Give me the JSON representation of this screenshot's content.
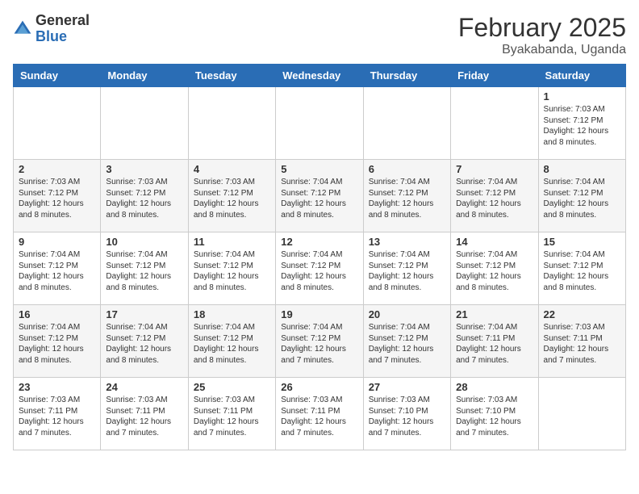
{
  "logo": {
    "general": "General",
    "blue": "Blue"
  },
  "header": {
    "month": "February 2025",
    "location": "Byakabanda, Uganda"
  },
  "weekdays": [
    "Sunday",
    "Monday",
    "Tuesday",
    "Wednesday",
    "Thursday",
    "Friday",
    "Saturday"
  ],
  "weeks": [
    [
      {
        "day": "",
        "info": ""
      },
      {
        "day": "",
        "info": ""
      },
      {
        "day": "",
        "info": ""
      },
      {
        "day": "",
        "info": ""
      },
      {
        "day": "",
        "info": ""
      },
      {
        "day": "",
        "info": ""
      },
      {
        "day": "1",
        "info": "Sunrise: 7:03 AM\nSunset: 7:12 PM\nDaylight: 12 hours\nand 8 minutes."
      }
    ],
    [
      {
        "day": "2",
        "info": "Sunrise: 7:03 AM\nSunset: 7:12 PM\nDaylight: 12 hours\nand 8 minutes."
      },
      {
        "day": "3",
        "info": "Sunrise: 7:03 AM\nSunset: 7:12 PM\nDaylight: 12 hours\nand 8 minutes."
      },
      {
        "day": "4",
        "info": "Sunrise: 7:03 AM\nSunset: 7:12 PM\nDaylight: 12 hours\nand 8 minutes."
      },
      {
        "day": "5",
        "info": "Sunrise: 7:04 AM\nSunset: 7:12 PM\nDaylight: 12 hours\nand 8 minutes."
      },
      {
        "day": "6",
        "info": "Sunrise: 7:04 AM\nSunset: 7:12 PM\nDaylight: 12 hours\nand 8 minutes."
      },
      {
        "day": "7",
        "info": "Sunrise: 7:04 AM\nSunset: 7:12 PM\nDaylight: 12 hours\nand 8 minutes."
      },
      {
        "day": "8",
        "info": "Sunrise: 7:04 AM\nSunset: 7:12 PM\nDaylight: 12 hours\nand 8 minutes."
      }
    ],
    [
      {
        "day": "9",
        "info": "Sunrise: 7:04 AM\nSunset: 7:12 PM\nDaylight: 12 hours\nand 8 minutes."
      },
      {
        "day": "10",
        "info": "Sunrise: 7:04 AM\nSunset: 7:12 PM\nDaylight: 12 hours\nand 8 minutes."
      },
      {
        "day": "11",
        "info": "Sunrise: 7:04 AM\nSunset: 7:12 PM\nDaylight: 12 hours\nand 8 minutes."
      },
      {
        "day": "12",
        "info": "Sunrise: 7:04 AM\nSunset: 7:12 PM\nDaylight: 12 hours\nand 8 minutes."
      },
      {
        "day": "13",
        "info": "Sunrise: 7:04 AM\nSunset: 7:12 PM\nDaylight: 12 hours\nand 8 minutes."
      },
      {
        "day": "14",
        "info": "Sunrise: 7:04 AM\nSunset: 7:12 PM\nDaylight: 12 hours\nand 8 minutes."
      },
      {
        "day": "15",
        "info": "Sunrise: 7:04 AM\nSunset: 7:12 PM\nDaylight: 12 hours\nand 8 minutes."
      }
    ],
    [
      {
        "day": "16",
        "info": "Sunrise: 7:04 AM\nSunset: 7:12 PM\nDaylight: 12 hours\nand 8 minutes."
      },
      {
        "day": "17",
        "info": "Sunrise: 7:04 AM\nSunset: 7:12 PM\nDaylight: 12 hours\nand 8 minutes."
      },
      {
        "day": "18",
        "info": "Sunrise: 7:04 AM\nSunset: 7:12 PM\nDaylight: 12 hours\nand 8 minutes."
      },
      {
        "day": "19",
        "info": "Sunrise: 7:04 AM\nSunset: 7:12 PM\nDaylight: 12 hours\nand 7 minutes."
      },
      {
        "day": "20",
        "info": "Sunrise: 7:04 AM\nSunset: 7:12 PM\nDaylight: 12 hours\nand 7 minutes."
      },
      {
        "day": "21",
        "info": "Sunrise: 7:04 AM\nSunset: 7:11 PM\nDaylight: 12 hours\nand 7 minutes."
      },
      {
        "day": "22",
        "info": "Sunrise: 7:03 AM\nSunset: 7:11 PM\nDaylight: 12 hours\nand 7 minutes."
      }
    ],
    [
      {
        "day": "23",
        "info": "Sunrise: 7:03 AM\nSunset: 7:11 PM\nDaylight: 12 hours\nand 7 minutes."
      },
      {
        "day": "24",
        "info": "Sunrise: 7:03 AM\nSunset: 7:11 PM\nDaylight: 12 hours\nand 7 minutes."
      },
      {
        "day": "25",
        "info": "Sunrise: 7:03 AM\nSunset: 7:11 PM\nDaylight: 12 hours\nand 7 minutes."
      },
      {
        "day": "26",
        "info": "Sunrise: 7:03 AM\nSunset: 7:11 PM\nDaylight: 12 hours\nand 7 minutes."
      },
      {
        "day": "27",
        "info": "Sunrise: 7:03 AM\nSunset: 7:10 PM\nDaylight: 12 hours\nand 7 minutes."
      },
      {
        "day": "28",
        "info": "Sunrise: 7:03 AM\nSunset: 7:10 PM\nDaylight: 12 hours\nand 7 minutes."
      },
      {
        "day": "",
        "info": ""
      }
    ]
  ]
}
